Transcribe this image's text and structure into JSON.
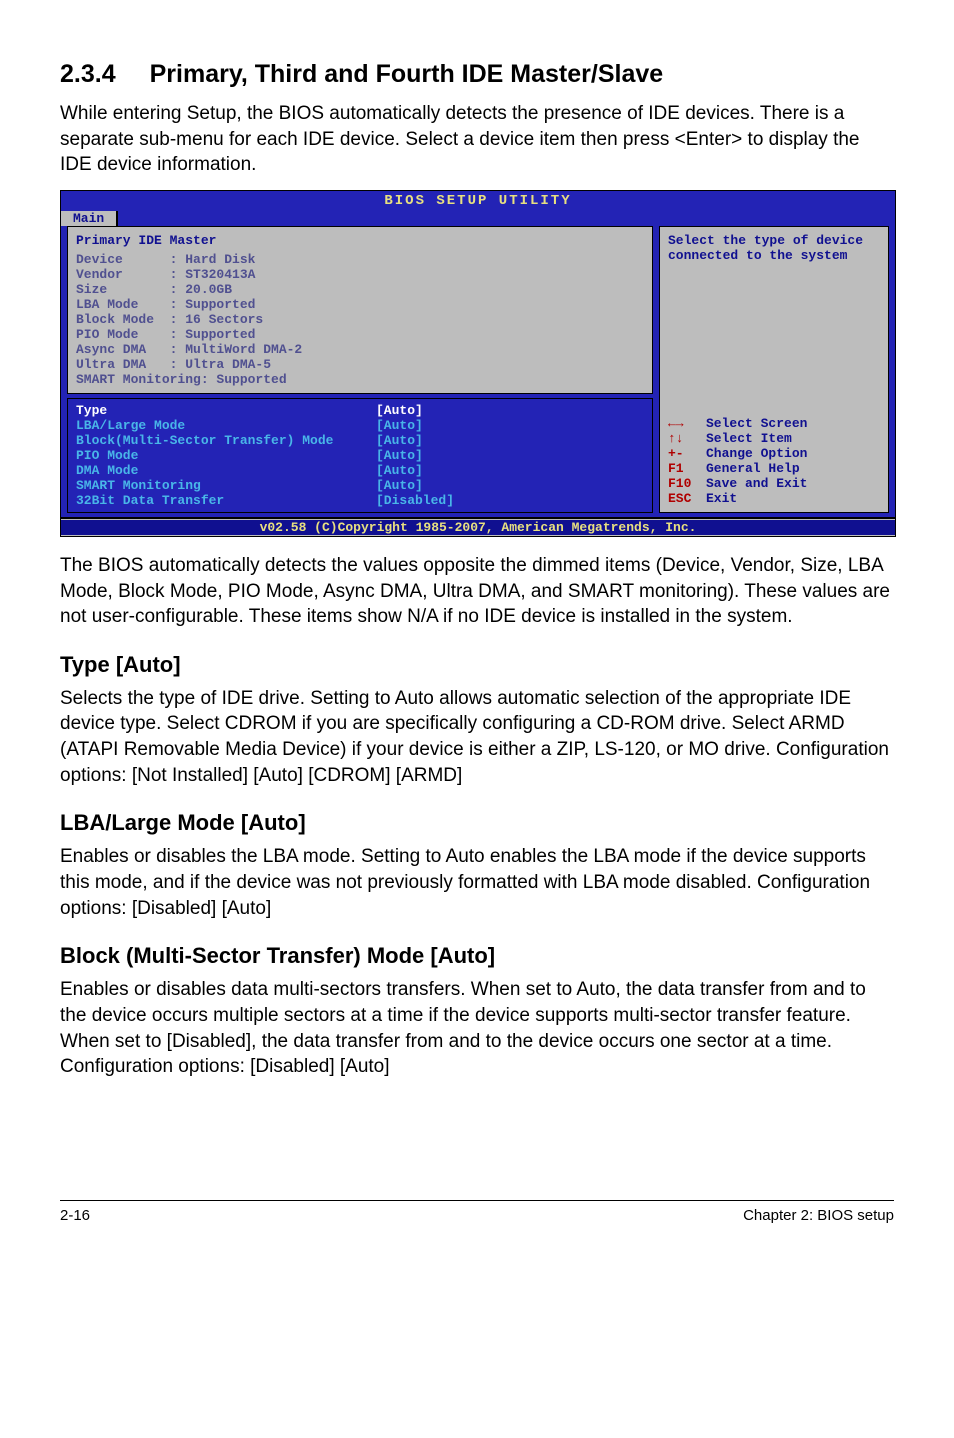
{
  "section": {
    "number": "2.3.4",
    "title": "Primary, Third and Fourth IDE Master/Slave"
  },
  "intro": "While entering Setup, the BIOS automatically detects the presence of IDE devices. There is a separate sub-menu for each IDE device. Select a device item then press <Enter> to display the IDE device information.",
  "bios": {
    "title": "BIOS SETUP UTILITY",
    "tab": "Main",
    "panel_heading": "Primary IDE Master",
    "info": {
      "Device": "Hard Disk",
      "Vendor": "ST320413A",
      "Size": "20.0GB",
      "LBA Mode": "Supported",
      "Block Mode": "16 Sectors",
      "PIO Mode": "Supported",
      "Async DMA": "MultiWord DMA-2",
      "Ultra DMA": "Ultra DMA-5",
      "SMART Monitoring": "Supported"
    },
    "options": [
      {
        "label": "Type",
        "value": "[Auto]",
        "selected": true
      },
      {
        "label": "LBA/Large Mode",
        "value": "[Auto]",
        "selected": false
      },
      {
        "label": "Block(Multi-Sector Transfer) Mode",
        "value": "[Auto]",
        "selected": false
      },
      {
        "label": "PIO Mode",
        "value": "[Auto]",
        "selected": false
      },
      {
        "label": "DMA Mode",
        "value": "[Auto]",
        "selected": false
      },
      {
        "label": "SMART Monitoring",
        "value": "[Auto]",
        "selected": false
      },
      {
        "label": "32Bit Data Transfer",
        "value": "[Disabled]",
        "selected": false
      }
    ],
    "help_top": "Select the type of device connected to the system",
    "help_keys": [
      {
        "key": "←→",
        "desc": "Select Screen"
      },
      {
        "key": "↑↓",
        "desc": "Select Item"
      },
      {
        "key": "+-",
        "desc": "Change Option"
      },
      {
        "key": "F1",
        "desc": "General Help"
      },
      {
        "key": "F10",
        "desc": "Save and Exit"
      },
      {
        "key": "ESC",
        "desc": "Exit"
      }
    ],
    "footer": "v02.58 (C)Copyright 1985-2007, American Megatrends, Inc."
  },
  "para_after_bios": "The BIOS automatically detects the values opposite the dimmed items (Device, Vendor, Size, LBA Mode, Block Mode, PIO Mode, Async DMA, Ultra DMA, and SMART monitoring). These values are not user-configurable. These items show N/A if no IDE device is installed in the system.",
  "type": {
    "heading": "Type [Auto]",
    "body": "Selects the type of IDE drive. Setting to Auto allows automatic selection of the appropriate IDE device type. Select CDROM if you are specifically configuring a CD-ROM drive. Select ARMD (ATAPI Removable Media Device) if your device is either a ZIP, LS-120, or MO drive. Configuration options: [Not Installed] [Auto] [CDROM] [ARMD]"
  },
  "lba": {
    "heading": "LBA/Large Mode [Auto]",
    "body": "Enables or disables the LBA mode. Setting to Auto enables the LBA mode if the device supports this mode, and if the device was not previously formatted with LBA mode disabled. Configuration options: [Disabled] [Auto]"
  },
  "block": {
    "heading": "Block (Multi-Sector Transfer) Mode [Auto]",
    "body": "Enables or disables data multi-sectors transfers. When set to Auto, the data transfer from and to the device occurs multiple sectors at a time if the device supports multi-sector transfer feature. When set to [Disabled], the data transfer from and to the device occurs one sector at a time. Configuration options: [Disabled] [Auto]"
  },
  "footer": {
    "left": "2-16",
    "right": "Chapter 2: BIOS setup"
  }
}
